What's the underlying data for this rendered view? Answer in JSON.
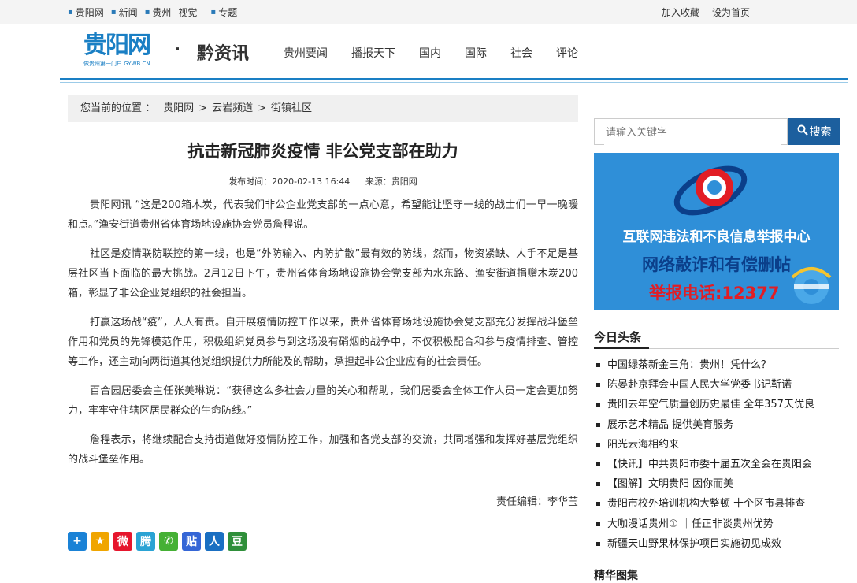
{
  "topnav": {
    "items": [
      "贵阳网",
      "新闻",
      "贵州",
      "视觉",
      "专题"
    ]
  },
  "topright": {
    "favorite": "加入收藏",
    "homepage": "设为首页"
  },
  "logo": {
    "main": "贵阳网",
    "sub": "做贵州第一门户 GYWB.CN"
  },
  "header": {
    "separator": "·",
    "channel": "黔资讯"
  },
  "mainnav": [
    "贵州要闻",
    "播报天下",
    "国内",
    "国际",
    "社会",
    "评论"
  ],
  "breadcrumb": {
    "prefix": "您当前的位置 ：",
    "items": [
      "贵阳网",
      "云岩频道",
      "街镇社区"
    ],
    "sep": ">"
  },
  "article": {
    "title": "抗击新冠肺炎疫情  非公党支部在助力",
    "publish_time": "发布时间：2020-02-13 16:44",
    "source": "来源：贵阳网",
    "paragraphs": [
      "贵阳网讯  “这是200箱木炭，代表我们非公企业党支部的一点心意，希望能让坚守一线的战士们一早一晚暖和点。”渔安街道贵州省体育场地设施协会党员詹程说。",
      "社区是疫情联防联控的第一线，也是“外防输入、内防扩散”最有效的防线，然而，物资紧缺、人手不足是基层社区当下面临的最大挑战。2月12日下午，贵州省体育场地设施协会党支部为水东路、渔安街道捐赠木炭200箱，彰显了非公企业党组织的社会担当。",
      "打赢这场战“疫”，人人有责。自开展疫情防控工作以来，贵州省体育场地设施协会党支部充分发挥战斗堡垒作用和党员的先锋模范作用，积极组织党员参与到这场没有硝烟的战争中，不仅积极配合和参与疫情排查、管控等工作，还主动向两街道其他党组织提供力所能及的帮助，承担起非公企业应有的社会责任。",
      "百合园居委会主任张美琳说：“获得这么多社会力量的关心和帮助，我们居委会全体工作人员一定会更加努力，牢牢守住辖区居民群众的生命防线。”",
      "詹程表示，将继续配合支持街道做好疫情防控工作，加强和各党支部的交流，共同增强和发挥好基层党组织的战斗堡垒作用。"
    ],
    "editor": "责任编辑：李华莹"
  },
  "share": [
    {
      "icon": "plus-share-icon",
      "glyph": "+",
      "color": "#1a82d6"
    },
    {
      "icon": "star-share-icon",
      "glyph": "★",
      "color": "#f0a500"
    },
    {
      "icon": "weibo-share-icon",
      "glyph": "微",
      "color": "#e6162d"
    },
    {
      "icon": "tencent-weibo-share-icon",
      "glyph": "腾",
      "color": "#2aa3d4"
    },
    {
      "icon": "wechat-share-icon",
      "glyph": "✆",
      "color": "#45b035"
    },
    {
      "icon": "tieba-share-icon",
      "glyph": "贴",
      "color": "#3566d6"
    },
    {
      "icon": "renren-share-icon",
      "glyph": "人",
      "color": "#1a6fc2"
    },
    {
      "icon": "douban-share-icon",
      "glyph": "豆",
      "color": "#2f8f3a"
    }
  ],
  "search": {
    "placeholder": "请输入关键字",
    "button": "搜索"
  },
  "banner": {
    "line1": "互联网违法和不良信息举报中心",
    "line2": "网络敲诈和有偿删帖",
    "line3": "举报电话:12377"
  },
  "headlines": {
    "title": "今日头条",
    "items": [
      "中国绿茶新金三角：贵州！凭什么？",
      "陈晏赴京拜会中国人民大学党委书记靳诺",
      "贵阳去年空气质量创历史最佳 全年357天优良",
      "展示艺术精品 提供美育服务",
      "阳光云海相约来",
      "【快讯】中共贵阳市委十届五次全会在贵阳会",
      "【图解】文明贵阳 因你而美",
      "贵阳市校外培训机构大整顿 十个区市县排查",
      "大咖漫话贵州① ｜任正非谈贵州优势",
      "新疆天山野果林保护项目实施初见成效"
    ]
  },
  "gallery": {
    "title": "精华图集"
  }
}
